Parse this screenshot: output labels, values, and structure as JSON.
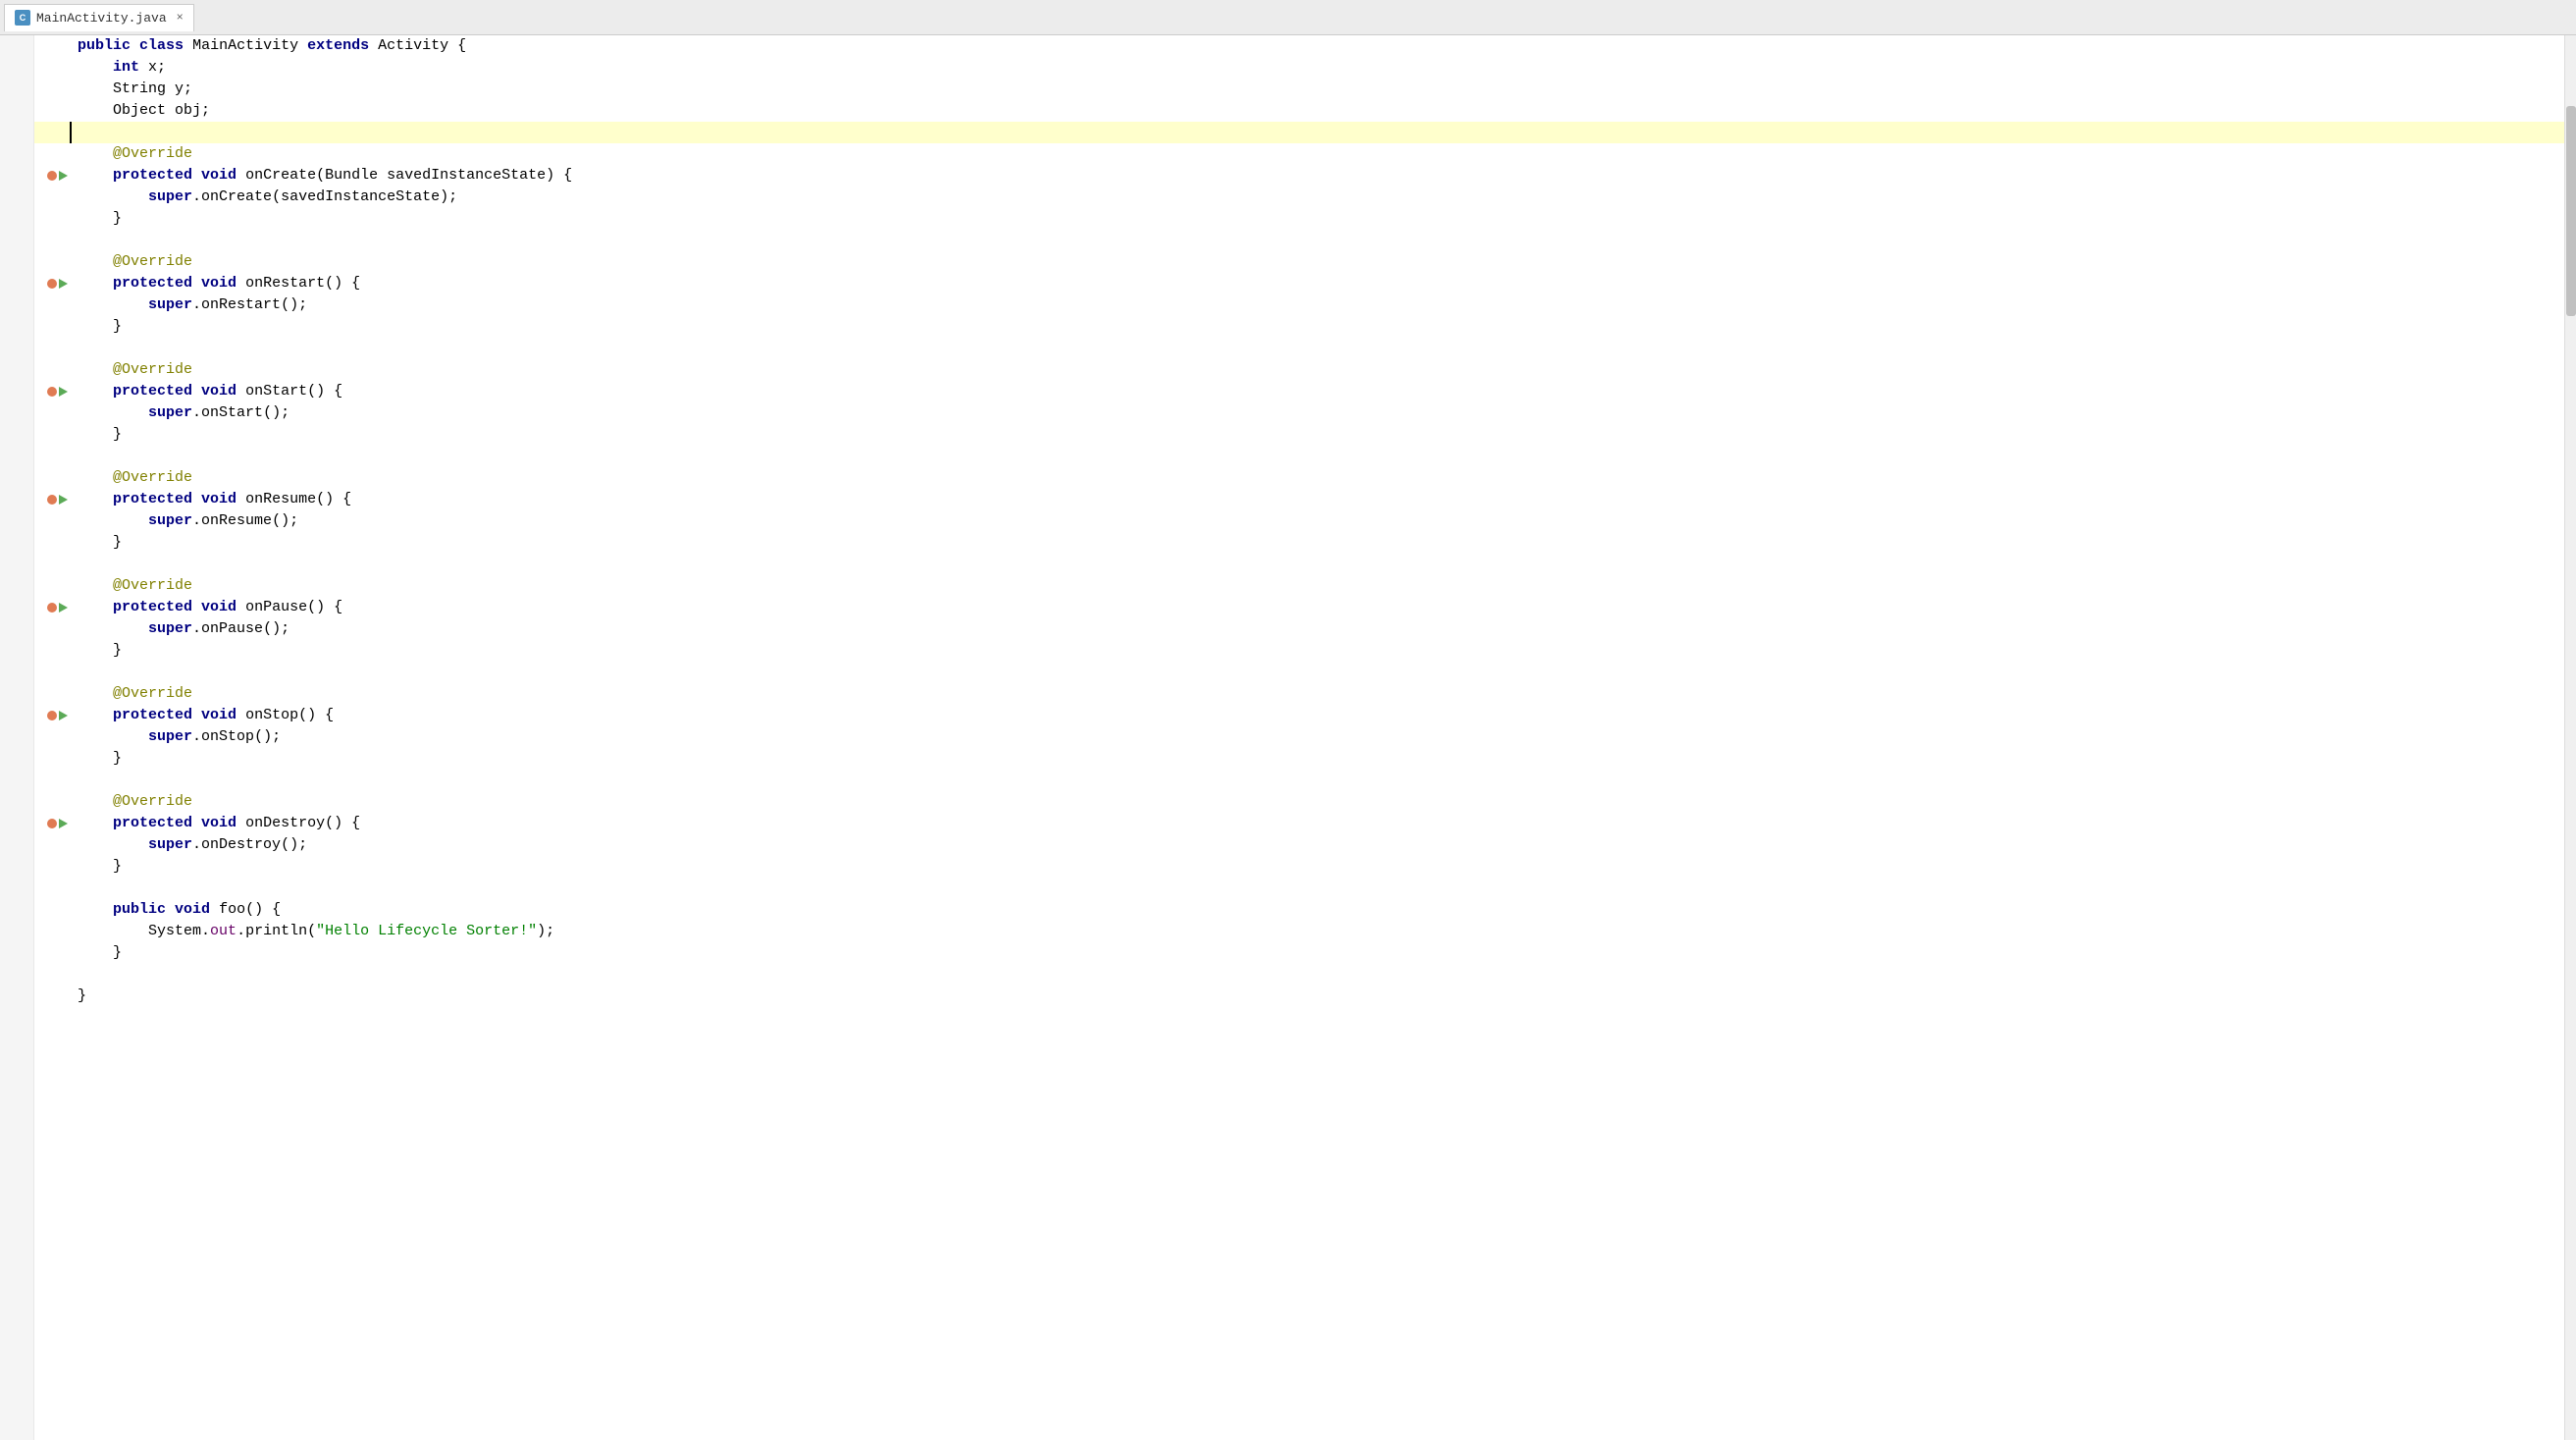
{
  "tab": {
    "icon_label": "C",
    "filename": "MainActivity.java",
    "close_label": "×"
  },
  "code": {
    "lines": [
      {
        "id": 1,
        "indent": 0,
        "has_run": false,
        "has_collapse": false,
        "has_override_dot": false,
        "content_html": "<span class='kw-modifier'>public</span> <span class='kw-class'>class</span> <span class='class-name'>MainActivity</span> <span class='kw-extends'>extends</span> <span class='class-name'>Activity</span> <span class='plain'>{</span>"
      },
      {
        "id": 2,
        "indent": 1,
        "has_run": false,
        "has_collapse": false,
        "has_override_dot": false,
        "content_html": "    <span class='kw-type'>int</span> <span class='plain'>x;</span>"
      },
      {
        "id": 3,
        "indent": 1,
        "has_run": false,
        "has_collapse": false,
        "has_override_dot": false,
        "content_html": "    <span class='class-name'>String</span> <span class='plain'>y;</span>"
      },
      {
        "id": 4,
        "indent": 1,
        "has_run": false,
        "has_collapse": false,
        "has_override_dot": false,
        "content_html": "    <span class='class-name'>Object</span> <span class='plain'>obj;</span>"
      },
      {
        "id": 5,
        "indent": 0,
        "is_cursor": true,
        "has_run": false,
        "has_collapse": false,
        "has_override_dot": false,
        "content_html": ""
      },
      {
        "id": 6,
        "indent": 1,
        "has_run": false,
        "has_collapse": false,
        "has_override_dot": false,
        "content_html": "    <span class='annotation'>@Override</span>"
      },
      {
        "id": 7,
        "indent": 1,
        "has_run": true,
        "has_collapse": true,
        "has_override_dot": true,
        "content_html": "    <span class='kw-modifier'>protected</span> <span class='kw-type'>void</span> <span class='method-name'>onCreate</span><span class='plain'>(</span><span class='class-name'>Bundle</span> <span class='plain'>savedInstanceState) {</span>"
      },
      {
        "id": 8,
        "indent": 2,
        "has_run": false,
        "has_collapse": false,
        "has_override_dot": false,
        "content_html": "        <span class='kw-super'>super</span><span class='plain'>.</span><span class='method-call'>onCreate</span><span class='plain'>(savedInstanceState);</span>"
      },
      {
        "id": 9,
        "indent": 1,
        "has_run": false,
        "has_collapse": false,
        "has_override_dot": false,
        "content_html": "    <span class='plain'>}</span>"
      },
      {
        "id": 10,
        "indent": 0,
        "has_run": false,
        "has_collapse": false,
        "has_override_dot": false,
        "content_html": ""
      },
      {
        "id": 11,
        "indent": 1,
        "has_run": false,
        "has_collapse": false,
        "has_override_dot": false,
        "content_html": "    <span class='annotation'>@Override</span>"
      },
      {
        "id": 12,
        "indent": 1,
        "has_run": true,
        "has_collapse": true,
        "has_override_dot": true,
        "content_html": "    <span class='kw-modifier'>protected</span> <span class='kw-type'>void</span> <span class='method-name'>onRestart</span><span class='plain'>() {</span>"
      },
      {
        "id": 13,
        "indent": 2,
        "has_run": false,
        "has_collapse": false,
        "has_override_dot": false,
        "content_html": "        <span class='kw-super'>super</span><span class='plain'>.</span><span class='method-call'>onRestart</span><span class='plain'>();</span>"
      },
      {
        "id": 14,
        "indent": 1,
        "has_run": false,
        "has_collapse": false,
        "has_override_dot": false,
        "content_html": "    <span class='plain'>}</span>"
      },
      {
        "id": 15,
        "indent": 0,
        "has_run": false,
        "has_collapse": false,
        "has_override_dot": false,
        "content_html": ""
      },
      {
        "id": 16,
        "indent": 1,
        "has_run": false,
        "has_collapse": false,
        "has_override_dot": false,
        "content_html": "    <span class='annotation'>@Override</span>"
      },
      {
        "id": 17,
        "indent": 1,
        "has_run": true,
        "has_collapse": true,
        "has_override_dot": true,
        "content_html": "    <span class='kw-modifier'>protected</span> <span class='kw-type'>void</span> <span class='method-name'>onStart</span><span class='plain'>() {</span>"
      },
      {
        "id": 18,
        "indent": 2,
        "has_run": false,
        "has_collapse": false,
        "has_override_dot": false,
        "content_html": "        <span class='kw-super'>super</span><span class='plain'>.</span><span class='method-call'>onStart</span><span class='plain'>();</span>"
      },
      {
        "id": 19,
        "indent": 1,
        "has_run": false,
        "has_collapse": false,
        "has_override_dot": false,
        "content_html": "    <span class='plain'>}</span>"
      },
      {
        "id": 20,
        "indent": 0,
        "has_run": false,
        "has_collapse": false,
        "has_override_dot": false,
        "content_html": ""
      },
      {
        "id": 21,
        "indent": 1,
        "has_run": false,
        "has_collapse": false,
        "has_override_dot": false,
        "content_html": "    <span class='annotation'>@Override</span>"
      },
      {
        "id": 22,
        "indent": 1,
        "has_run": true,
        "has_collapse": true,
        "has_override_dot": true,
        "content_html": "    <span class='kw-modifier'>protected</span> <span class='kw-type'>void</span> <span class='method-name'>onResume</span><span class='plain'>() {</span>"
      },
      {
        "id": 23,
        "indent": 2,
        "has_run": false,
        "has_collapse": false,
        "has_override_dot": false,
        "content_html": "        <span class='kw-super'>super</span><span class='plain'>.</span><span class='method-call'>onResume</span><span class='plain'>();</span>"
      },
      {
        "id": 24,
        "indent": 1,
        "has_run": false,
        "has_collapse": false,
        "has_override_dot": false,
        "content_html": "    <span class='plain'>}</span>"
      },
      {
        "id": 25,
        "indent": 0,
        "has_run": false,
        "has_collapse": false,
        "has_override_dot": false,
        "content_html": ""
      },
      {
        "id": 26,
        "indent": 1,
        "has_run": false,
        "has_collapse": false,
        "has_override_dot": false,
        "content_html": "    <span class='annotation'>@Override</span>"
      },
      {
        "id": 27,
        "indent": 1,
        "has_run": true,
        "has_collapse": true,
        "has_override_dot": true,
        "content_html": "    <span class='kw-modifier'>protected</span> <span class='kw-type'>void</span> <span class='method-name'>onPause</span><span class='plain'>() {</span>"
      },
      {
        "id": 28,
        "indent": 2,
        "has_run": false,
        "has_collapse": false,
        "has_override_dot": false,
        "content_html": "        <span class='kw-super'>super</span><span class='plain'>.</span><span class='method-call'>onPause</span><span class='plain'>();</span>"
      },
      {
        "id": 29,
        "indent": 1,
        "has_run": false,
        "has_collapse": false,
        "has_override_dot": false,
        "content_html": "    <span class='plain'>}</span>"
      },
      {
        "id": 30,
        "indent": 0,
        "has_run": false,
        "has_collapse": false,
        "has_override_dot": false,
        "content_html": ""
      },
      {
        "id": 31,
        "indent": 1,
        "has_run": false,
        "has_collapse": false,
        "has_override_dot": false,
        "content_html": "    <span class='annotation'>@Override</span>"
      },
      {
        "id": 32,
        "indent": 1,
        "has_run": true,
        "has_collapse": true,
        "has_override_dot": true,
        "content_html": "    <span class='kw-modifier'>protected</span> <span class='kw-type'>void</span> <span class='method-name'>onStop</span><span class='plain'>() {</span>"
      },
      {
        "id": 33,
        "indent": 2,
        "has_run": false,
        "has_collapse": false,
        "has_override_dot": false,
        "content_html": "        <span class='kw-super'>super</span><span class='plain'>.</span><span class='method-call'>onStop</span><span class='plain'>();</span>"
      },
      {
        "id": 34,
        "indent": 1,
        "has_run": false,
        "has_collapse": false,
        "has_override_dot": false,
        "content_html": "    <span class='plain'>}</span>"
      },
      {
        "id": 35,
        "indent": 0,
        "has_run": false,
        "has_collapse": false,
        "has_override_dot": false,
        "content_html": ""
      },
      {
        "id": 36,
        "indent": 1,
        "has_run": false,
        "has_collapse": false,
        "has_override_dot": false,
        "content_html": "    <span class='annotation'>@Override</span>"
      },
      {
        "id": 37,
        "indent": 1,
        "has_run": true,
        "has_collapse": true,
        "has_override_dot": true,
        "content_html": "    <span class='kw-modifier'>protected</span> <span class='kw-type'>void</span> <span class='method-name'>onDestroy</span><span class='plain'>() {</span>"
      },
      {
        "id": 38,
        "indent": 2,
        "has_run": false,
        "has_collapse": false,
        "has_override_dot": false,
        "content_html": "        <span class='kw-super'>super</span><span class='plain'>.</span><span class='method-call'>onDestroy</span><span class='plain'>();</span>"
      },
      {
        "id": 39,
        "indent": 1,
        "has_run": false,
        "has_collapse": false,
        "has_override_dot": false,
        "content_html": "    <span class='plain'>}</span>"
      },
      {
        "id": 40,
        "indent": 0,
        "has_run": false,
        "has_collapse": false,
        "has_override_dot": false,
        "content_html": ""
      },
      {
        "id": 41,
        "indent": 1,
        "has_run": false,
        "has_collapse": true,
        "has_override_dot": false,
        "content_html": "    <span class='kw-modifier'>public</span> <span class='kw-type'>void</span> <span class='method-name'>foo</span><span class='plain'>() {</span>"
      },
      {
        "id": 42,
        "indent": 2,
        "has_run": false,
        "has_collapse": false,
        "has_override_dot": false,
        "content_html": "        <span class='class-name'>System</span><span class='plain'>.</span><span class='field-name'>out</span><span class='plain'>.</span><span class='method-call'>println</span><span class='plain'>(</span><span class='string-val'>\"Hello Lifecycle Sorter!\"</span><span class='plain'>);</span>"
      },
      {
        "id": 43,
        "indent": 1,
        "has_run": false,
        "has_collapse": false,
        "has_override_dot": false,
        "content_html": "    <span class='plain'>}</span>"
      },
      {
        "id": 44,
        "indent": 0,
        "has_run": false,
        "has_collapse": false,
        "has_override_dot": false,
        "content_html": ""
      },
      {
        "id": 45,
        "indent": 0,
        "has_run": false,
        "has_collapse": false,
        "has_override_dot": false,
        "content_html": "<span class='plain'>}</span>"
      }
    ]
  }
}
